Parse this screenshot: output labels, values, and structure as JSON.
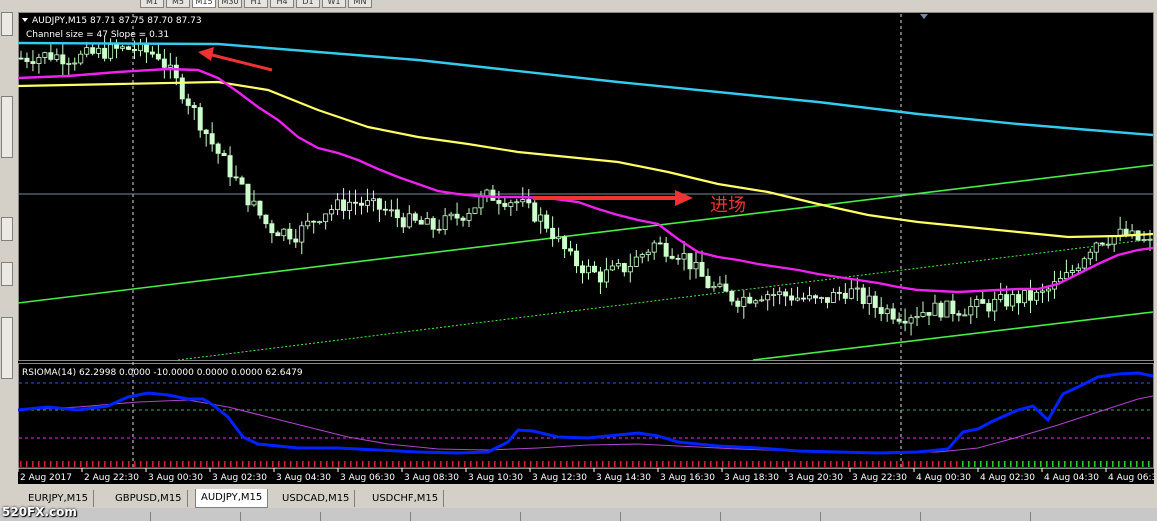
{
  "window": {
    "timeframes": [
      "M1",
      "M5",
      "M15",
      "M30",
      "H1",
      "H4",
      "D1",
      "W1",
      "MN"
    ],
    "active_timeframe": "M15"
  },
  "chart": {
    "symbol_header": "AUDJPY,M15  87.71 87.75 87.70 87.73",
    "channel_info": "Channel size = 47 Slope = 0.31",
    "annotation_entry": "进场",
    "colors": {
      "background": "#000000",
      "bull_candle": "#ccffcc",
      "bear_candle": "#ccffcc",
      "ma_cyan": "#33ccee",
      "ma_yellow": "#ffff66",
      "ma_magenta": "#ee22ee",
      "channel": "#44ee44",
      "arrow": "#ee3333",
      "rsioma": "#0022ff",
      "rsioma_signal": "#aa44cc"
    }
  },
  "indicator": {
    "header": "RSIOMA(14) 62.2998 0.0000 -10.0000 0.0000 0.0000 62.6479"
  },
  "time_axis": [
    "2 Aug 2017",
    "2 Aug 22:30",
    "3 Aug 00:30",
    "3 Aug 02:30",
    "3 Aug 04:30",
    "3 Aug 06:30",
    "3 Aug 08:30",
    "3 Aug 10:30",
    "3 Aug 12:30",
    "3 Aug 14:30",
    "3 Aug 16:30",
    "3 Aug 18:30",
    "3 Aug 20:30",
    "3 Aug 22:30",
    "4 Aug 00:30",
    "4 Aug 02:30",
    "4 Aug 04:30",
    "4 Aug 06:30"
  ],
  "tabs": [
    "EURJPY,M15",
    "GBPUSD,M15",
    "AUDJPY,M15",
    "USDCAD,M15",
    "USDCHF,M15"
  ],
  "active_tab": "AUDJPY,M15",
  "watermark": "520FX.com",
  "chart_data": {
    "type": "line",
    "title": "AUDJPY,M15",
    "price_series_approx_close": [
      87.72,
      87.73,
      87.72,
      87.74,
      87.75,
      87.73,
      87.6,
      87.45,
      87.32,
      87.2,
      87.18,
      87.25,
      87.28,
      87.26,
      87.22,
      87.2,
      87.24,
      87.3,
      87.28,
      87.22,
      87.1,
      87.05,
      87.08,
      87.15,
      87.12,
      87.02,
      86.98,
      87.0,
      86.99,
      86.97,
      87.01,
      86.96,
      86.93,
      86.95,
      86.95,
      86.96,
      86.98,
      86.99,
      87.05,
      87.16,
      87.18,
      87.15
    ],
    "series": [
      {
        "name": "RSIOMA(14)",
        "last_value": 62.2998
      },
      {
        "name": "RSIOMA signal",
        "last_value": 62.6479
      }
    ]
  }
}
